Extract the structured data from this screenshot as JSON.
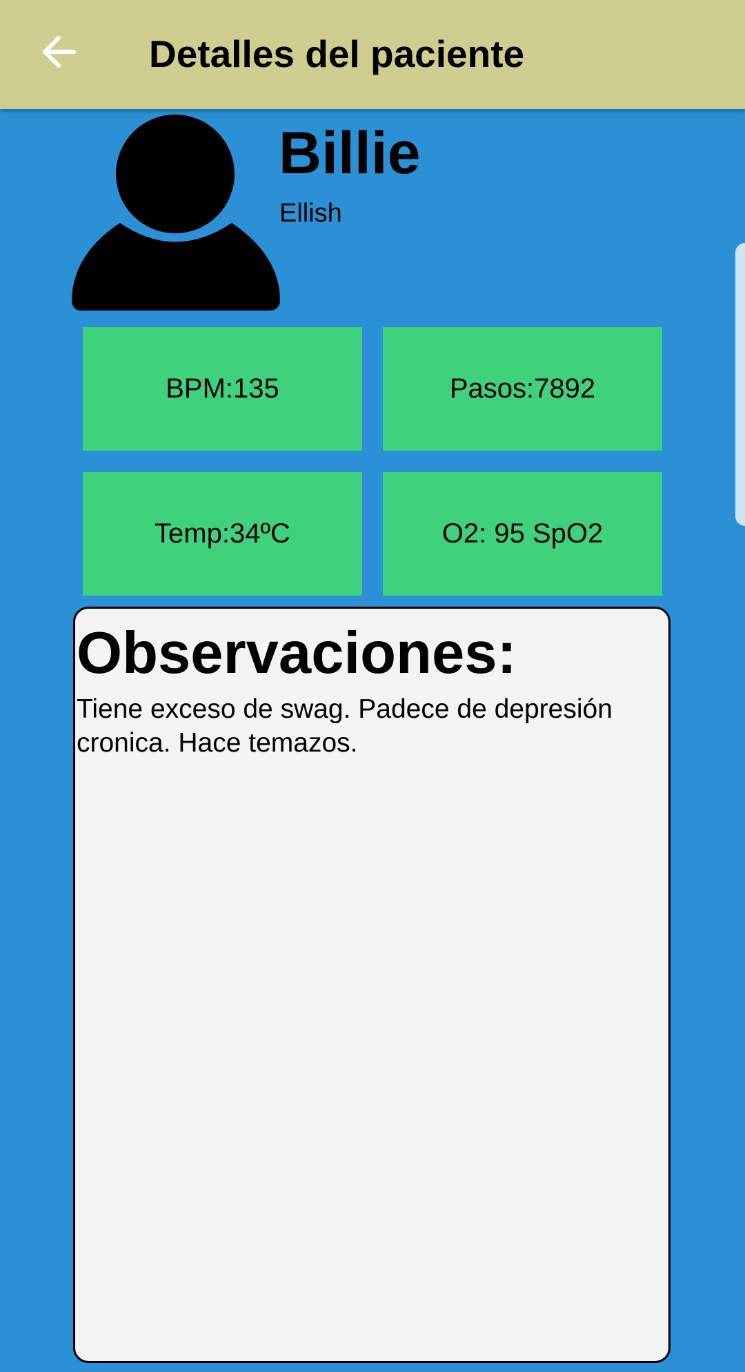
{
  "app_bar": {
    "back_icon": "arrow-left-icon",
    "title": "Detalles del paciente",
    "background": "#d0cd90"
  },
  "patient": {
    "avatar_icon": "person-silhouette-icon",
    "first_name": "Billie",
    "last_name": "Ellish"
  },
  "metrics": {
    "bpm": "BPM:135",
    "steps": "Pasos:7892",
    "temperature": "Temp:34ºC",
    "oxygen": "O2: 95 SpO2"
  },
  "observations": {
    "title": "Observaciones:",
    "text": "Tiene exceso de swag. Padece de depresión cronica. Hace temazos."
  },
  "colors": {
    "page_background": "#2b90d6",
    "tile": "#3fd17c",
    "panel": "#f4f4f4"
  }
}
